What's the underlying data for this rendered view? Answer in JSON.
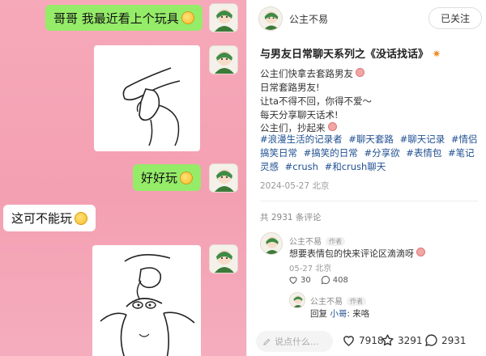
{
  "chat": {
    "messages": [
      {
        "side": "right",
        "text": "哥哥 我最近看上个玩具"
      },
      {
        "side": "right",
        "kind": "image"
      },
      {
        "side": "right",
        "text": "好好玩"
      },
      {
        "side": "left",
        "text": "这可不能玩"
      },
      {
        "side": "right",
        "kind": "image"
      }
    ]
  },
  "post": {
    "author": "公主不易",
    "follow_label": "已关注",
    "title": "与男友日常聊天系列之《没话找话》",
    "body_lines": [
      "公主们快拿去套路男友",
      "日常套路男友!",
      "让ta不得不回，你得不爱～",
      "每天分享聊天话术!",
      "公主们，抄起来"
    ],
    "tags": [
      "#浪漫生活的记录者",
      "#聊天套路",
      "#聊天记录",
      "#情侣搞笑日常",
      "#搞笑的日常",
      "#分享欲",
      "#表情包",
      "#笔记灵感",
      "#crush",
      "#和crush聊天"
    ],
    "date": "2024-05-27 北京"
  },
  "comments": {
    "count_label": "共 2931 条评论",
    "items": [
      {
        "name": "公主不易",
        "tag": "作者",
        "text": "想要表情包的快来评论区滴滴呀",
        "meta": "05-27 北京",
        "likes": "30",
        "replies": "408"
      }
    ],
    "reply": {
      "name": "公主不易",
      "tag": "作者",
      "prefix": "回复",
      "target": "小哥",
      "text": ": 来咯"
    }
  },
  "bottom": {
    "input_placeholder": "说点什么...",
    "likes": "7918",
    "stars": "3291",
    "comments": "2931"
  },
  "colors": {
    "chat_bg": "#f5a9ba",
    "green_bubble": "#95ec69",
    "tag_blue": "#1f4f91"
  }
}
